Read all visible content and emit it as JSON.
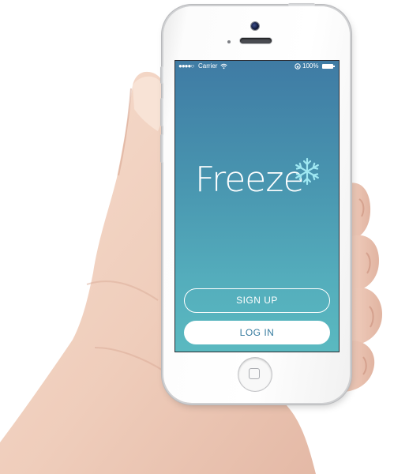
{
  "status_bar": {
    "signal": "●●●●○",
    "carrier": "Carrier",
    "wifi_icon": "wifi-icon",
    "lock_icon": "rotation-lock-icon",
    "battery": "100%",
    "battery_icon": "battery-icon"
  },
  "app": {
    "logo_text": "Freeze",
    "logo_icon": "snowflake-icon",
    "signup_label": "SIGN UP",
    "login_label": "LOG IN",
    "colors": {
      "gradient_top": "#3f7ba4",
      "gradient_bottom": "#5ab9c0",
      "snowflake": "#9fe8f2",
      "login_text": "#357a9e"
    }
  },
  "device": {
    "home_icon": "home-button-icon"
  }
}
